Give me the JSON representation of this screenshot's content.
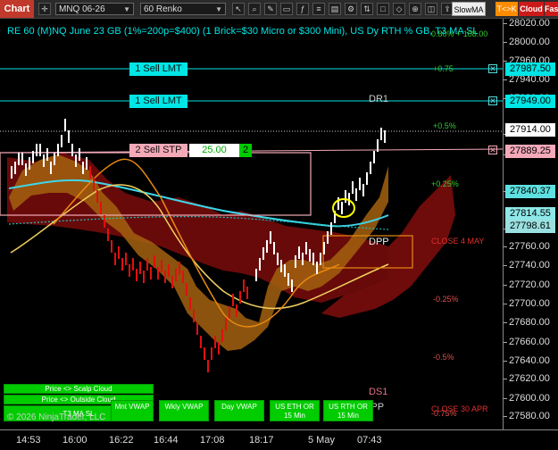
{
  "toolbar": {
    "chart_tab": "Chart",
    "instrument": "MNQ 06-26",
    "bar_type": "60 Renko",
    "indicator": "SlowMA",
    "tc_label": "T<>K",
    "cloud_label": "Cloud",
    "fast_label": "Fast"
  },
  "title": "RE 60 (M)NQ June 23 GB (1%=200p=$400) (1 Brick=$30 Micro or $300 Mini), US Dy RTH % GB, T3 MA SL",
  "orders": {
    "sell_lmt_1": "1 Sell LMT",
    "sell_lmt_2": "1 Sell LMT",
    "sell_stp": "2 Sell STP",
    "sell_stp_price": "25.00",
    "sell_stp_qty": "2"
  },
  "levels": {
    "top_pct": "0.80% + 108.00",
    "p075": "+0.75",
    "p05": "+0.5%",
    "p025": "+0.25%",
    "m025": "-0.25%",
    "m05": "-0.5%",
    "m075": "-0.75%",
    "dr1": "DR1",
    "dpp": "DPP",
    "ds1": "DS1",
    "wpp": "WPP",
    "close_may": "CLOSE 4 MAY",
    "close_apr": "CLOSE 30 APR"
  },
  "yaxis": {
    "labels": [
      "28020.00",
      "28000.00",
      "27960.00",
      "27940.00",
      "27920.00",
      "27880.00",
      "27860.00",
      "27820.00",
      "27780.00",
      "27760.00",
      "27740.00",
      "27720.00",
      "27700.00",
      "27680.00",
      "27660.00",
      "27640.00",
      "27620.00",
      "27600.00",
      "27580.00"
    ],
    "price_boxes": [
      {
        "label": "27987.50",
        "color": "#00e5e5"
      },
      {
        "label": "27949.00",
        "color": "#00e5e5"
      },
      {
        "label": "27914.00",
        "color": "#ffffff"
      },
      {
        "label": "27889.25",
        "color": "#f4a9b8"
      },
      {
        "label": "27840.37",
        "color": "#5ee0e0"
      },
      {
        "label": "27814.55",
        "color": "#8ee8e8"
      },
      {
        "label": "27798.61",
        "color": "#9ae0e0"
      }
    ]
  },
  "xaxis": {
    "labels": [
      "14:53",
      "16:00",
      "16:22",
      "16:44",
      "17:08",
      "18:17",
      "5 May",
      "07:43"
    ]
  },
  "panel_buttons": {
    "scalp_cloud": "Price <> Scalp Cloud",
    "outside_cloud": "Price <> Outside Cloud",
    "t3_ma_sl": "T3 MA SL",
    "mnt_vwap": "Mnt VWAP",
    "wkly_vwap": "Wkly VWAP",
    "day_vwap": "Day VWAP",
    "us_eth": "US ETH OR 15 Min",
    "us_rth": "US RTH OR 15 Min"
  },
  "copyright": "© 2026 NinjaTrader, LLC",
  "colors": {
    "cyan": "#00e5e5",
    "pink": "#f4a9b8",
    "green_button": "#00cc00",
    "cloud_red": "#8b0000",
    "cloud_orange": "#b8690a",
    "brick_red": "#e01010",
    "brick_white": "#ffffff"
  }
}
